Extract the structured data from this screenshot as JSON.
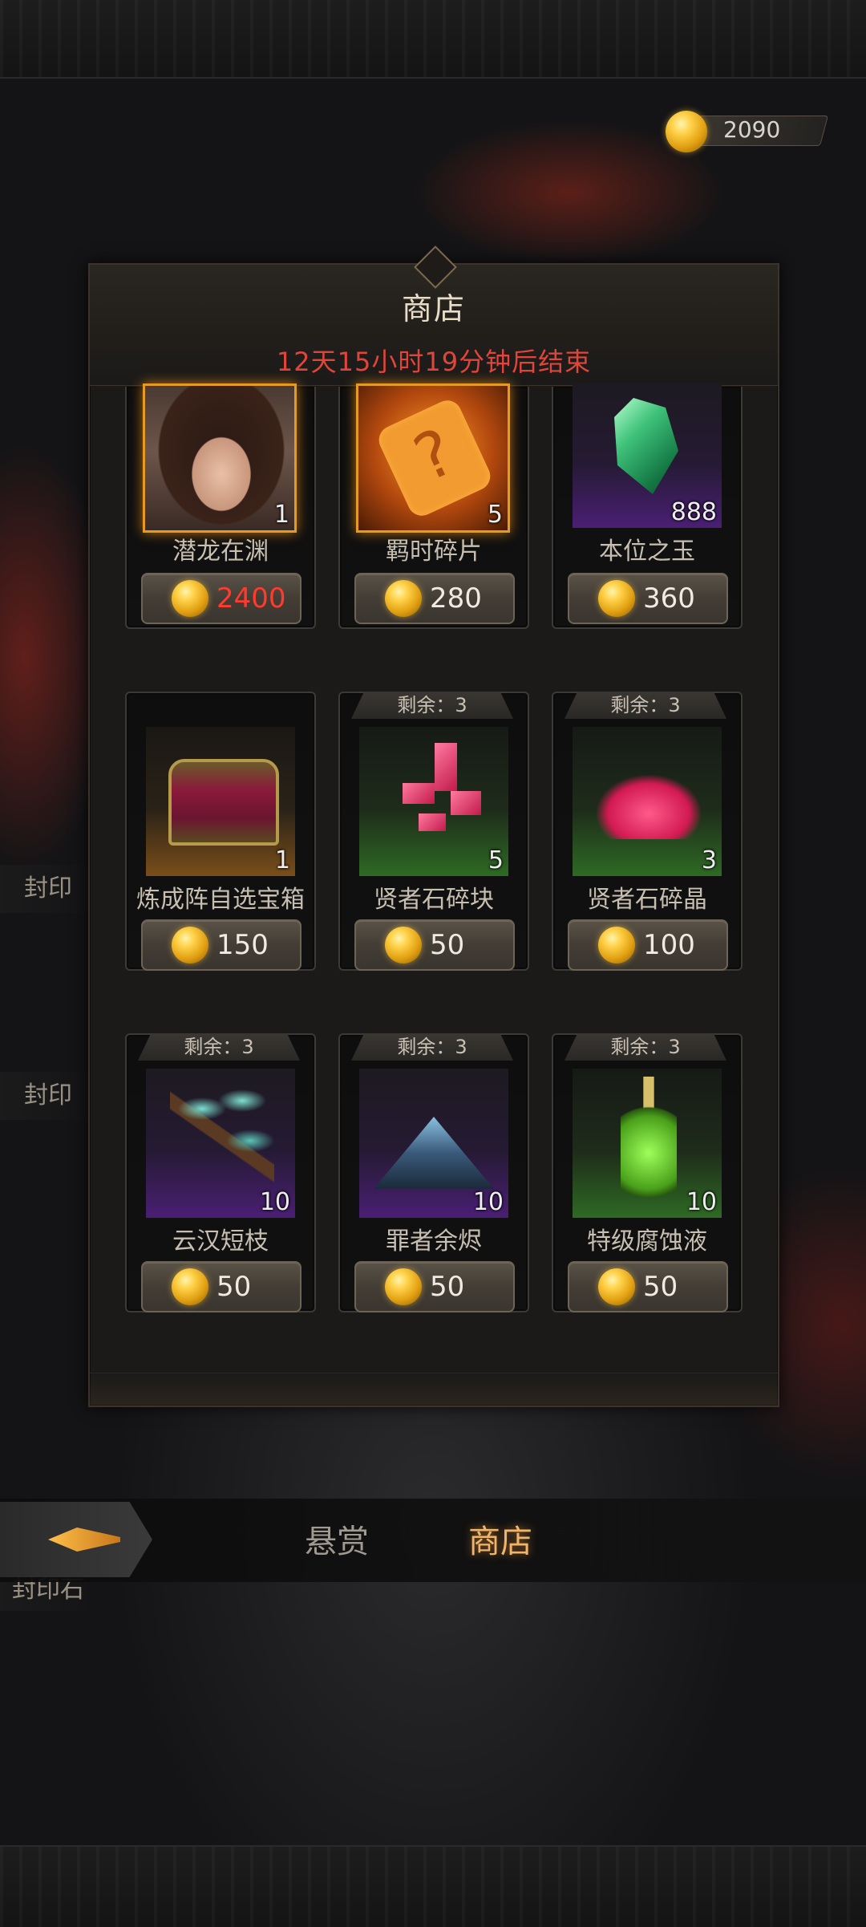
{
  "currency": {
    "icon": "gold-coin-icon",
    "amount": "2090"
  },
  "side_labels": [
    "封印",
    "封印",
    "封印石"
  ],
  "shop": {
    "title": "商店",
    "countdown": "12天15小时19分钟后结束",
    "items": [
      {
        "name": "潜龙在渊",
        "qty": "1",
        "price": "2400",
        "price_color": "#ff3b30",
        "remaining": "",
        "rarity": "legendary",
        "icon": "portrait-icon"
      },
      {
        "name": "羁时碎片",
        "qty": "5",
        "price": "280",
        "remaining": "",
        "rarity": "legendary",
        "icon": "puzzle-piece-icon"
      },
      {
        "name": "本位之玉",
        "qty": "888",
        "price": "360",
        "remaining": "",
        "rarity": "epic",
        "icon": "emerald-gem-icon"
      },
      {
        "name": "炼成阵自选宝箱",
        "qty": "1",
        "price": "150",
        "remaining": "",
        "rarity": "rare",
        "icon": "treasure-chest-icon"
      },
      {
        "name": "贤者石碎块",
        "qty": "5",
        "price": "50",
        "remaining": "剩余：3",
        "rarity": "uncommon",
        "icon": "crystal-shards-icon"
      },
      {
        "name": "贤者石碎晶",
        "qty": "3",
        "price": "100",
        "remaining": "剩余：3",
        "rarity": "uncommon",
        "icon": "crystal-cluster-icon"
      },
      {
        "name": "云汉短枝",
        "qty": "10",
        "price": "50",
        "remaining": "剩余：3",
        "rarity": "epic",
        "icon": "branch-icon"
      },
      {
        "name": "罪者余烬",
        "qty": "10",
        "price": "50",
        "remaining": "剩余：3",
        "rarity": "epic",
        "icon": "ember-ash-icon"
      },
      {
        "name": "特级腐蚀液",
        "qty": "10",
        "price": "50",
        "remaining": "剩余：3",
        "rarity": "uncommon",
        "icon": "potion-icon"
      }
    ]
  },
  "tabs": [
    {
      "label": "悬赏",
      "active": false
    },
    {
      "label": "商店",
      "active": true
    }
  ],
  "back_button": {
    "icon": "back-arrow-icon"
  },
  "colors": {
    "accent": "#f0b56a",
    "countdown": "#e0453a",
    "price_insufficient": "#ff3b30"
  }
}
